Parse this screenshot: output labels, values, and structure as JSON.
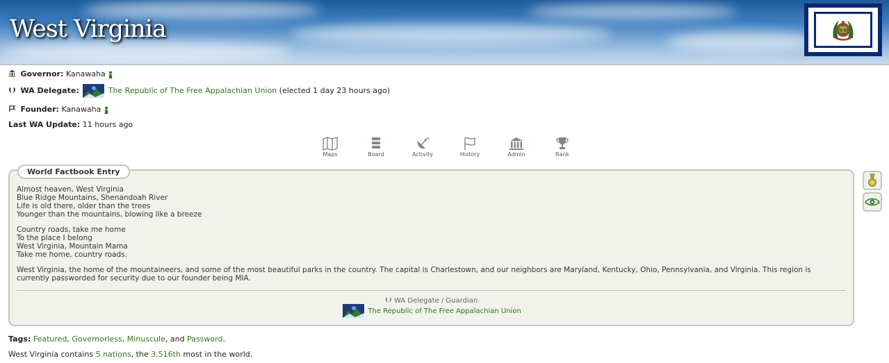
{
  "region": {
    "name": "West Virginia"
  },
  "info": {
    "governor_label": "Governor:",
    "governor_value": "Kanawaha",
    "delegate_label": "WA Delegate:",
    "delegate_value": "The Republic of The Free Appalachian Union",
    "delegate_note": "(elected 1 day 23 hours ago)",
    "founder_label": "Founder:",
    "founder_value": "Kanawaha",
    "update_label": "Last WA Update:",
    "update_value": "11 hours ago"
  },
  "nav": [
    {
      "label": "Maps",
      "icon": "map-icon"
    },
    {
      "label": "Board",
      "icon": "board-icon"
    },
    {
      "label": "Activity",
      "icon": "satellite-dish-icon"
    },
    {
      "label": "History",
      "icon": "flag-icon"
    },
    {
      "label": "Admin",
      "icon": "bank-icon"
    },
    {
      "label": "Rank",
      "icon": "trophy-icon"
    }
  ],
  "factbook": {
    "tab_label": "World Factbook Entry",
    "paragraphs": [
      "Almost heaven, West Virginia\nBlue Ridge Mountains, Shenandoah River\nLife is old there, older than the trees\nYounger than the mountains, blowing like a breeze",
      "Country roads, take me home\nTo the place I belong\nWest Virginia, Mountain Mama\nTake me home, country roads.",
      "West Virginia, the home of the mountaineers, and some of the most beautiful parks in the country. The capital is Charlestown, and our neighbors are Maryland, Kentucky, Ohio, Pennsylvania, and Virginia. This region is currently passworded for security due to our founder being MIA."
    ],
    "signature_role": "WA Delegate / Guardian",
    "signature_nation": "The Republic of The Free Appalachian Union"
  },
  "side_buttons": [
    {
      "icon": "medal-icon"
    },
    {
      "icon": "eye-icon"
    }
  ],
  "tags": {
    "label": "Tags:",
    "items": [
      "Featured",
      "Governorless",
      "Minuscule",
      "Password"
    ],
    "sep1": ", ",
    "sep2": ", ",
    "sep3": ", and ",
    "end": "."
  },
  "contains": {
    "prefix": "West Virginia contains ",
    "nations": "5 nations",
    "middle": ", the ",
    "rank": "3,516th",
    "suffix": " most in the world."
  },
  "colors": {
    "link": "#2a7a1a",
    "flag_blue": "#0a2a6e",
    "panel_bg": "#f2f2ec"
  }
}
